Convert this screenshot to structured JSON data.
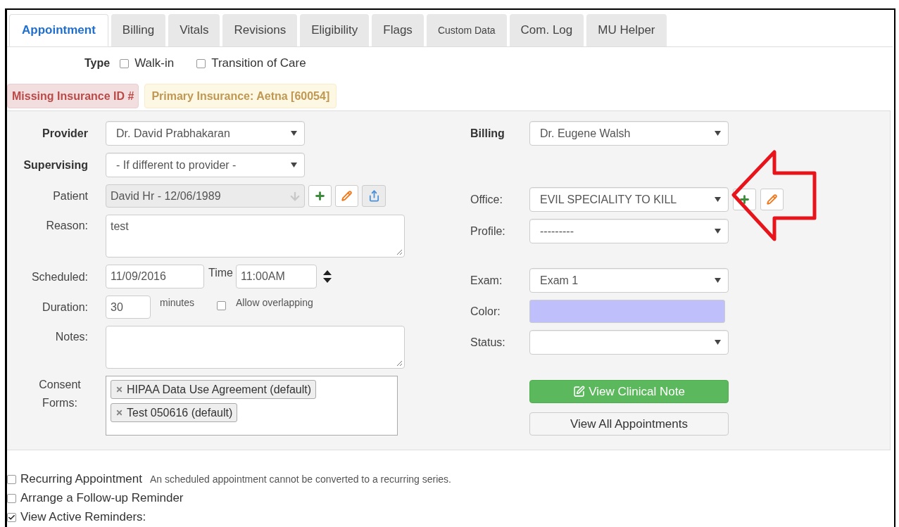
{
  "tabs": [
    {
      "label": "Appointment",
      "selected": true,
      "kind": "normal"
    },
    {
      "label": "Billing",
      "selected": false,
      "kind": "normal"
    },
    {
      "label": "Vitals",
      "selected": false,
      "kind": "normal"
    },
    {
      "label": "Revisions",
      "selected": false,
      "kind": "normal"
    },
    {
      "label": "Eligibility",
      "selected": false,
      "kind": "normal"
    },
    {
      "label": "Flags",
      "selected": false,
      "kind": "normal"
    },
    {
      "label": "Custom Data",
      "selected": false,
      "kind": "small"
    },
    {
      "label": "Com. Log",
      "selected": false,
      "kind": "normal"
    },
    {
      "label": "MU Helper",
      "selected": false,
      "kind": "normal"
    }
  ],
  "type": {
    "label": "Type",
    "options": [
      {
        "label": "Walk-in",
        "checked": false
      },
      {
        "label": "Transition of Care",
        "checked": false
      }
    ]
  },
  "alerts": [
    {
      "text": "Missing Insurance ID #",
      "kind": "danger"
    },
    {
      "text": "Primary Insurance: Aetna [60054]",
      "kind": "warning"
    }
  ],
  "left_fields": [
    {
      "kind": "select",
      "label": "Provider",
      "bold": true,
      "value": "Dr. David Prabhakaran"
    },
    {
      "kind": "select",
      "label": "Supervising",
      "bold": true,
      "value": "- If different to provider -"
    },
    {
      "kind": "patient",
      "label": "Patient",
      "bold": false,
      "value": "David Hr - 12/06/1989",
      "disabled": true
    },
    {
      "kind": "textarea",
      "label": "Reason:",
      "bold": false,
      "value": "test"
    },
    {
      "kind": "datetime",
      "label": "Scheduled:",
      "bold": false,
      "value": "11/09/2016",
      "time_label": "Time",
      "time": "11:00AM"
    },
    {
      "kind": "duration",
      "label": "Duration:",
      "bold": false,
      "value": "30",
      "unit": "minutes",
      "overlap": {
        "label": "Allow overlapping",
        "checked": false
      }
    },
    {
      "kind": "textarea",
      "label": "Notes:",
      "bold": false
    },
    {
      "kind": "tags",
      "label": "Consent Forms:",
      "bold": false,
      "tags": [
        "HIPAA Data Use Agreement (default)",
        "Test 050616 (default)"
      ]
    }
  ],
  "right_groups": [
    [
      {
        "kind": "select",
        "label": "Billing",
        "bold": true,
        "value": "Dr. Eugene Walsh"
      }
    ],
    [
      {
        "kind": "office",
        "label": "Office:",
        "bold": false,
        "value": "EVIL SPECIALITY TO KILL"
      },
      {
        "kind": "select",
        "label": "Profile:",
        "bold": false,
        "value": "---------"
      }
    ],
    [
      {
        "kind": "select",
        "label": "Exam:",
        "bold": false,
        "value": "Exam 1"
      },
      {
        "kind": "color",
        "label": "Color:",
        "bold": false,
        "color": "#bfbffc"
      },
      {
        "kind": "select",
        "label": "Status:",
        "bold": false
      }
    ],
    [
      {
        "kind": "primary_button",
        "label": "View Clinical Note"
      },
      {
        "kind": "button",
        "label": "View All Appointments"
      }
    ]
  ],
  "options": [
    {
      "label": "Recurring Appointment",
      "checked": false,
      "note": "An scheduled appointment cannot be converted to a recurring series."
    },
    {
      "label": "Arrange a Follow-up Reminder",
      "checked": false
    },
    {
      "label": "View Active Reminders:",
      "checked": true
    }
  ]
}
